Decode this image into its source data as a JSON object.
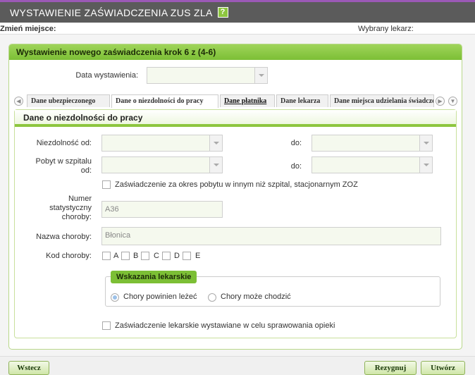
{
  "window": {
    "title": "WYSTAWIENIE ZAŚWIADCZENIA ZUS ZLA",
    "help_glyph": "?"
  },
  "topinfo": {
    "change_place": "Zmień miejsce:",
    "chosen_doctor": "Wybrany lekarz:"
  },
  "panel": {
    "title": "Wystawienie nowego zaświadczenia krok 6 z (4-6)",
    "issue_date_label": "Data wystawienia:",
    "issue_date_value": ""
  },
  "tabs": [
    {
      "label": "Dane ubezpieczonego"
    },
    {
      "label": "Dane o niezdolności do pracy"
    },
    {
      "label": "Dane płatnika"
    },
    {
      "label": "Dane lekarza"
    },
    {
      "label": "Dane miejsca udzielania świadczeń"
    }
  ],
  "inner": {
    "title": "Dane o niezdolności do pracy",
    "incapacity_from_label": "Niezdolność od:",
    "to_label": "do:",
    "hospital_from_label": "Pobyt w szpitalu od:",
    "other_facility_label": "Zaświadczenie za okres pobytu w innym niż szpital, stacjonarnym ZOZ",
    "stat_number_label": "Numer statystyczny choroby:",
    "stat_number_value": "A36",
    "disease_name_label": "Nazwa choroby:",
    "disease_name_value": "Błonica",
    "disease_code_label": "Kod choroby:",
    "codes": [
      "A",
      "B",
      "C",
      "D",
      "E"
    ],
    "indications_title": "Wskazania lekarskie",
    "radio_lying": "Chory powinien leżeć",
    "radio_walking": "Chory może chodzić",
    "care_label": "Zaświadczenie lekarskie wystawiane w celu sprawowania opieki"
  },
  "buttons": {
    "back": "Wstecz",
    "cancel": "Rezygnuj",
    "create": "Utwórz"
  },
  "colors": {
    "accent": "#8dc63f",
    "titlebar": "#5b5b5b",
    "top_stripe": "#9b59b6"
  }
}
